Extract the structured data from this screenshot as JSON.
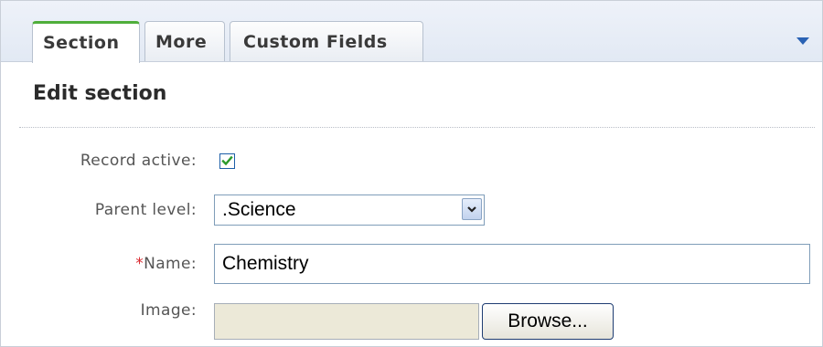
{
  "tabs": [
    {
      "label": "Section",
      "active": true
    },
    {
      "label": "More",
      "active": false
    },
    {
      "label": "Custom Fields",
      "active": false
    }
  ],
  "heading": "Edit section",
  "form": {
    "record_active": {
      "label": "Record active:",
      "checked": true
    },
    "parent_level": {
      "label": "Parent level:",
      "value": ".Science"
    },
    "name": {
      "required_marker": "*",
      "label": "Name:",
      "value": "Chemistry"
    },
    "image": {
      "label": "Image:",
      "value": "",
      "browse_label": "Browse..."
    }
  },
  "colors": {
    "active_tab_accent": "#4fae3b",
    "required_marker": "#d9262c",
    "dropdown_arrow": "#2a62b4",
    "checkmark": "#2b9a2b"
  },
  "icons": {
    "tab_menu": "chevron-down-icon",
    "select": "chevron-down-icon",
    "checkbox": "checkmark-icon"
  }
}
